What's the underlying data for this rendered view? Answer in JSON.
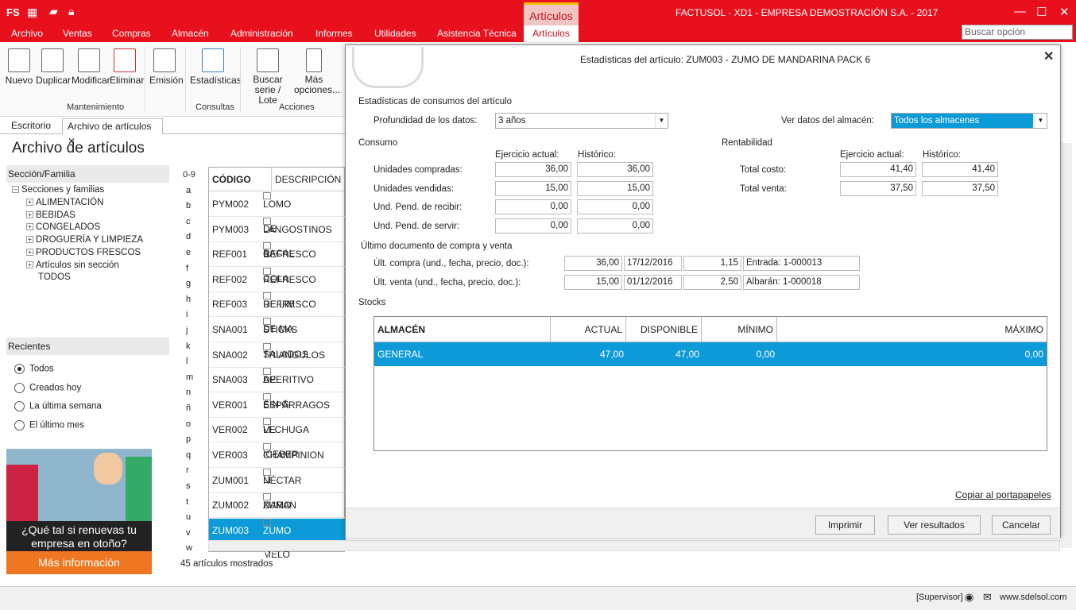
{
  "app": {
    "title": "FACTUSOL - XD1 - EMPRESA DEMOSTRACIÓN S.A. - 2017",
    "logo": "FS",
    "accent": "#e8101c",
    "selection": "#0c9bd8"
  },
  "menu": [
    "Archivo",
    "Ventas",
    "Compras",
    "Almacén",
    "Administración",
    "Informes",
    "Utilidades",
    "Asistencia Técnica"
  ],
  "context_tab": {
    "title": "Artículos",
    "sub": "Artículos"
  },
  "search": {
    "placeholder": "Buscar opción"
  },
  "ribbon": {
    "buttons": [
      "Nuevo",
      "Duplicar",
      "Modificar",
      "Eliminar",
      "Emisión",
      "Estadísticas",
      "Buscar serie / Lote",
      "Más opciones..."
    ],
    "groups": [
      "Mantenimiento",
      "Consultas",
      "Acciones"
    ]
  },
  "doc_tabs": [
    "Escritorio",
    "Archivo de artículos"
  ],
  "page_title": "Archivo de artículos",
  "sidebar": {
    "header": "Sección/Familia",
    "root": "Secciones y familias",
    "items": [
      "ALIMENTACIÓN",
      "BEBIDAS",
      "CONGELADOS",
      "DROGUERÍA Y LIMPIEZA",
      "PRODUCTOS FRESCOS",
      "Artículos sin sección",
      "TODOS"
    ]
  },
  "recientes": {
    "header": "Recientes",
    "options": [
      "Todos",
      "Creados hoy",
      "La última semana",
      "El último mes"
    ],
    "selected": 0
  },
  "ad": {
    "question": "¿Qué tal si renuevas tu empresa en otoño?",
    "button": "Más información"
  },
  "letters": [
    "0-9",
    "a",
    "b",
    "c",
    "d",
    "e",
    "f",
    "g",
    "h",
    "i",
    "j",
    "k",
    "l",
    "m",
    "n",
    "ñ",
    "o",
    "p",
    "q",
    "r",
    "s",
    "t",
    "u",
    "v",
    "w"
  ],
  "grid": {
    "columns": [
      "CÓDIGO",
      "DESCRIPCIÓN"
    ],
    "rows": [
      [
        "PYM002",
        "LOMO DE BACAL"
      ],
      [
        "PYM003",
        "LANGOSTINOS C"
      ],
      [
        "REF001",
        "REFRESCO COLA"
      ],
      [
        "REF002",
        "REFRESCO DE LIM"
      ],
      [
        "REF003",
        "REFRESCO DE MA"
      ],
      [
        "SNA001",
        "STICKS SALADOS"
      ],
      [
        "SNA002",
        "TRIANGULOS DE"
      ],
      [
        "SNA003",
        "APERITIVO SIN G"
      ],
      [
        "VER001",
        "ESPÁRRAGOS VE"
      ],
      [
        "VER002",
        "LECHUGA ICEBER"
      ],
      [
        "VER003",
        "CHAMPINION LI"
      ],
      [
        "ZUM001",
        "NÉCTAR NARAN"
      ],
      [
        "ZUM002",
        "ZUMO DE MELO"
      ],
      [
        "ZUM003",
        "ZUMO DE MAND"
      ]
    ],
    "selected": 13
  },
  "count": "45 artículos mostrados",
  "dialog": {
    "title": "Estadísticas del artículo: ZUM003 - ZUMO DE MANDARINA PACK 6",
    "section": "Estadísticas de consumos del artículo",
    "depth_label": "Profundidad de los datos:",
    "depth_value": "3 años",
    "store_label": "Ver datos del almacén:",
    "store_value": "Todos los almacenes",
    "consumo": {
      "title": "Consumo",
      "col1": "Ejercicio actual:",
      "col2": "Histórico:",
      "rows": [
        [
          "Unidades compradas:",
          "36,00",
          "36,00"
        ],
        [
          "Unidades vendidas:",
          "15,00",
          "15,00"
        ],
        [
          "Und. Pend. de recibir:",
          "0,00",
          "0,00"
        ],
        [
          "Und. Pend. de servir:",
          "0,00",
          "0,00"
        ]
      ]
    },
    "rent": {
      "title": "Rentabilidad",
      "col1": "Ejercicio actual:",
      "col2": "Histórico:",
      "rows": [
        [
          "Total costo:",
          "41,40",
          "41,40"
        ],
        [
          "Total venta:",
          "37,50",
          "37,50"
        ]
      ]
    },
    "ultimo": {
      "title": "Último documento de compra y venta",
      "rows": [
        [
          "Últ. compra (und., fecha, precio, doc.):",
          "36,00",
          "17/12/2016",
          "1,15",
          "Entrada: 1-000013"
        ],
        [
          "Últ. venta (und., fecha, precio, doc.):",
          "15,00",
          "01/12/2016",
          "2,50",
          "Albarán: 1-000018"
        ]
      ]
    },
    "stocks": {
      "title": "Stocks",
      "columns": [
        "ALMACÉN",
        "ACTUAL",
        "DISPONIBLE",
        "MÍNIMO",
        "MÁXIMO"
      ],
      "rows": [
        [
          "GENERAL",
          "47,00",
          "47,00",
          "0,00",
          "0,00"
        ]
      ]
    },
    "copy": "Copiar al portapapeles",
    "buttons": [
      "Imprimir",
      "Ver resultados",
      "Cancelar"
    ]
  },
  "status": {
    "user": "[Supervisor]",
    "site": "www.sdelsol.com"
  }
}
